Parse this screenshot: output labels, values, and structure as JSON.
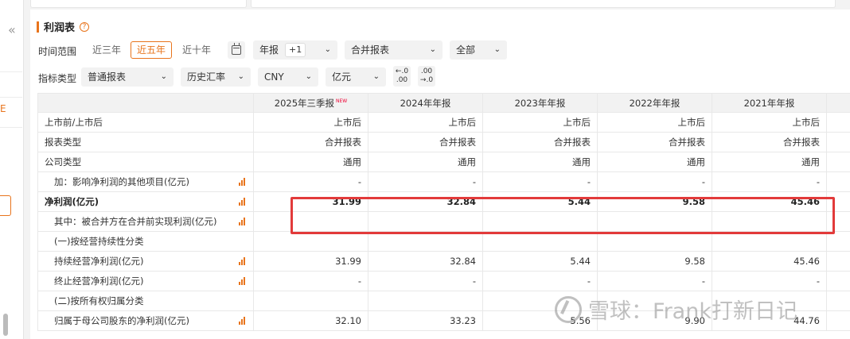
{
  "sidebar": {
    "collapse_glyph": "«",
    "active_glyph": "E"
  },
  "panel": {
    "title": "利润表",
    "help_glyph": "?"
  },
  "filters": {
    "time_range_label": "时间范围",
    "time_options": [
      "近三年",
      "近五年",
      "近十年"
    ],
    "time_selected": "近五年",
    "period_select": "年报",
    "period_extra": "+1",
    "report_select": "合并报表",
    "scope_select": "全部",
    "indicator_label": "指标类型",
    "indicator_select": "普通报表",
    "rate_select": "历史汇率",
    "currency_select": "CNY",
    "unit_select": "亿元",
    "decimal_decrease": "←.0\n.00",
    "decimal_increase": ".00\n→.0"
  },
  "table": {
    "columns": [
      "2025年三季报",
      "2024年年报",
      "2023年年报",
      "2022年年报",
      "2021年年报"
    ],
    "new_badge": "NEW",
    "rows": [
      {
        "name": "上市前/上市后",
        "values": [
          "上市后",
          "上市后",
          "上市后",
          "上市后",
          "上市后"
        ]
      },
      {
        "name": "报表类型",
        "values": [
          "合并报表",
          "合并报表",
          "合并报表",
          "合并报表",
          "合并报表"
        ]
      },
      {
        "name": "公司类型",
        "values": [
          "通用",
          "通用",
          "通用",
          "通用",
          "通用"
        ]
      },
      {
        "name": "加：影响净利润的其他项目(亿元)",
        "values": [
          "-",
          "-",
          "-",
          "-",
          "-"
        ]
      },
      {
        "name": "净利润(亿元)",
        "values": [
          "31.99",
          "32.84",
          "5.44",
          "9.58",
          "45.46"
        ]
      },
      {
        "name": "其中：被合并方在合并前实现利润(亿元)",
        "values": [
          "",
          "",
          "",
          "",
          ""
        ]
      },
      {
        "name": "(一)按经营持续性分类",
        "values": [
          "",
          "",
          "",
          "",
          ""
        ]
      },
      {
        "name": "持续经营净利润(亿元)",
        "values": [
          "31.99",
          "32.84",
          "5.44",
          "9.58",
          "45.46"
        ]
      },
      {
        "name": "终止经营净利润(亿元)",
        "values": [
          "-",
          "-",
          "-",
          "-",
          "-"
        ]
      },
      {
        "name": "(二)按所有权归属分类",
        "values": [
          "",
          "",
          "",
          "",
          ""
        ]
      },
      {
        "name": "归属于母公司股东的净利润(亿元)",
        "values": [
          "32.10",
          "33.23",
          "5.56",
          "9.90",
          "44.76"
        ]
      }
    ]
  },
  "watermark": {
    "text": "雪球：Frank打新日记"
  },
  "colors": {
    "accent": "#e8741c",
    "highlight": "#e23a3a"
  }
}
